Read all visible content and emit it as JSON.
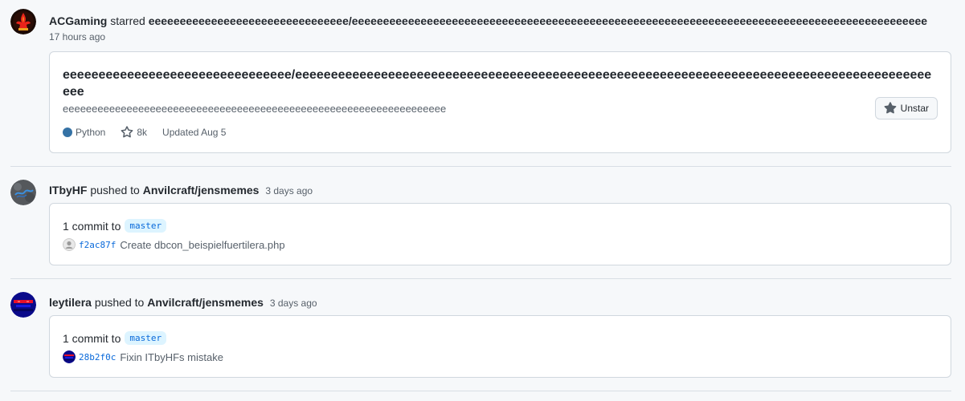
{
  "feed": [
    {
      "actor": "ACGaming",
      "verb": "starred",
      "target": "eeeeeeeeeeeeeeeeeeeeeeeeeeeeeeee/eeeeeeeeeeeeeeeeeeeeeeeeeeeeeeeeeeeeeeeeeeeeeeeeeeeeeeeeeeeeeeeeeeeeeeeeeeeeeeeeeeeeeeeeeeee",
      "time": "17 hours ago",
      "repo": {
        "name": "eeeeeeeeeeeeeeeeeeeeeeeeeeeeeeee/eeeeeeeeeeeeeeeeeeeeeeeeeeeeeeeeeeeeeeeeeeeeeeeeeeeeeeeeeeeeeeeeeeeeeeeeeeeeeeeeeeeeeeeeeeee",
        "description": "eeeeeeeeeeeeeeeeeeeeeeeeeeeeeeeeeeeeeeeeeeeeeeeeeeeeeeeeeeeeeeeeee",
        "language": "Python",
        "language_color": "#3572A5",
        "stars": "8k",
        "updated": "Updated Aug 5",
        "button_label": "Unstar"
      }
    },
    {
      "actor": "ITbyHF",
      "verb": "pushed to",
      "target": "Anvilcraft/jensmemes",
      "time": "3 days ago",
      "commit_count": "1 commit to",
      "branch": "master",
      "commit_sha": "f2ac87f",
      "commit_message": "Create dbcon_beispielfuertilera.php"
    },
    {
      "actor": "leytilera",
      "verb": "pushed to",
      "target": "Anvilcraft/jensmemes",
      "time": "3 days ago",
      "commit_count": "1 commit to",
      "branch": "master",
      "commit_sha": "28b2f0c",
      "commit_message": "Fixin ITbyHFs mistake"
    }
  ],
  "colors": {
    "link": "#0969da",
    "muted": "#57606a",
    "border": "#d0d7de"
  }
}
